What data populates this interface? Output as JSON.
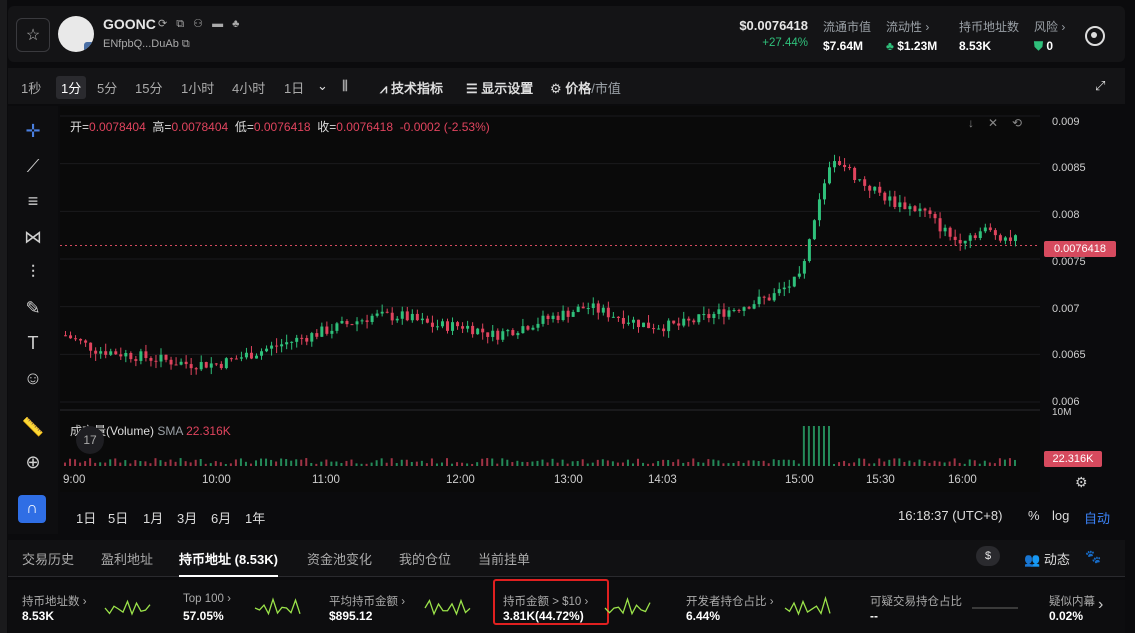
{
  "header": {
    "token_name": "GOONC",
    "token_address": "ENfpbQ...DuAb",
    "price": "$0.0076418",
    "change": "+27.44%",
    "stats": [
      {
        "label": "流通市值",
        "value": "$7.64M"
      },
      {
        "label": "流动性 ›",
        "value": "$1.23M"
      },
      {
        "label": "持币地址数",
        "value": "8.53K"
      },
      {
        "label": "风险 ›",
        "value": "0"
      }
    ]
  },
  "timeframes": [
    "1秒",
    "1分",
    "5分",
    "15分",
    "1小时",
    "4小时",
    "1日"
  ],
  "active_timeframe": "1分",
  "toolbar": {
    "indicators": "技术指标",
    "display": "显示设置",
    "price": "价格",
    "mcap": "/市值"
  },
  "ohlc": {
    "open_label": "开=",
    "open": "0.0078404",
    "high_label": "高=",
    "high": "0.0078404",
    "low_label": "低=",
    "low": "0.0076418",
    "close_label": "收=",
    "close": "0.0076418",
    "change": "-0.0002 (-2.53%)"
  },
  "volume": {
    "label": "成交量(Volume)",
    "sma": "SMA",
    "value": "22.316K",
    "axis_top": "10M"
  },
  "chart_data": {
    "type": "candlestick",
    "y_ticks": [
      "0.009",
      "0.0085",
      "0.008",
      "0.0075",
      "0.007",
      "0.0065",
      "0.006"
    ],
    "ylim": [
      0.006,
      0.009
    ],
    "x_ticks": [
      "9:00",
      "10:00",
      "11:00",
      "12:00",
      "13:00",
      "14:03",
      "15:00",
      "15:30",
      "16:00"
    ],
    "current_price_tag": "0.0076418",
    "volume_tag": "22.316K",
    "series_close_approx": [
      0.0067,
      0.00655,
      0.0065,
      0.00645,
      0.0064,
      0.0064,
      0.0065,
      0.0066,
      0.0067,
      0.0068,
      0.0069,
      0.0069,
      0.0068,
      0.0068,
      0.0067,
      0.0068,
      0.0069,
      0.007,
      0.0069,
      0.0068,
      0.0068,
      0.0069,
      0.007,
      0.0071,
      0.0073,
      0.0086,
      0.0083,
      0.0081,
      0.008,
      0.0077,
      0.0078,
      0.0077
    ]
  },
  "ranges": [
    "1日",
    "5日",
    "1月",
    "3月",
    "6月",
    "1年"
  ],
  "clock": "16:18:37 (UTC+8)",
  "scale_opts": {
    "pct": "%",
    "log": "log",
    "auto": "自动"
  },
  "tabs": [
    "交易历史",
    "盈利地址",
    "持币地址 (8.53K)",
    "资金池变化",
    "我的仓位",
    "当前挂单"
  ],
  "active_tab": "持币地址 (8.53K)",
  "tab_right": {
    "currency": "$",
    "activity": "动态"
  },
  "metrics": [
    {
      "label": "持币地址数 ›",
      "value": "8.53K"
    },
    {
      "label": "Top 100 ›",
      "value": "57.05%"
    },
    {
      "label": "平均持币金额 ›",
      "value": "$895.12"
    },
    {
      "label": "持币金额 > $10 ›",
      "value": "3.81K(44.72%)"
    },
    {
      "label": "开发者持仓占比 ›",
      "value": "6.44%"
    },
    {
      "label": "可疑交易持仓占比",
      "value": "--"
    },
    {
      "label": "疑似内幕",
      "value": "0.02%"
    }
  ],
  "colors": {
    "up": "#2fc07b",
    "down": "#e0445e",
    "highlight": "#e02020",
    "accent": "#3b6fe0"
  }
}
